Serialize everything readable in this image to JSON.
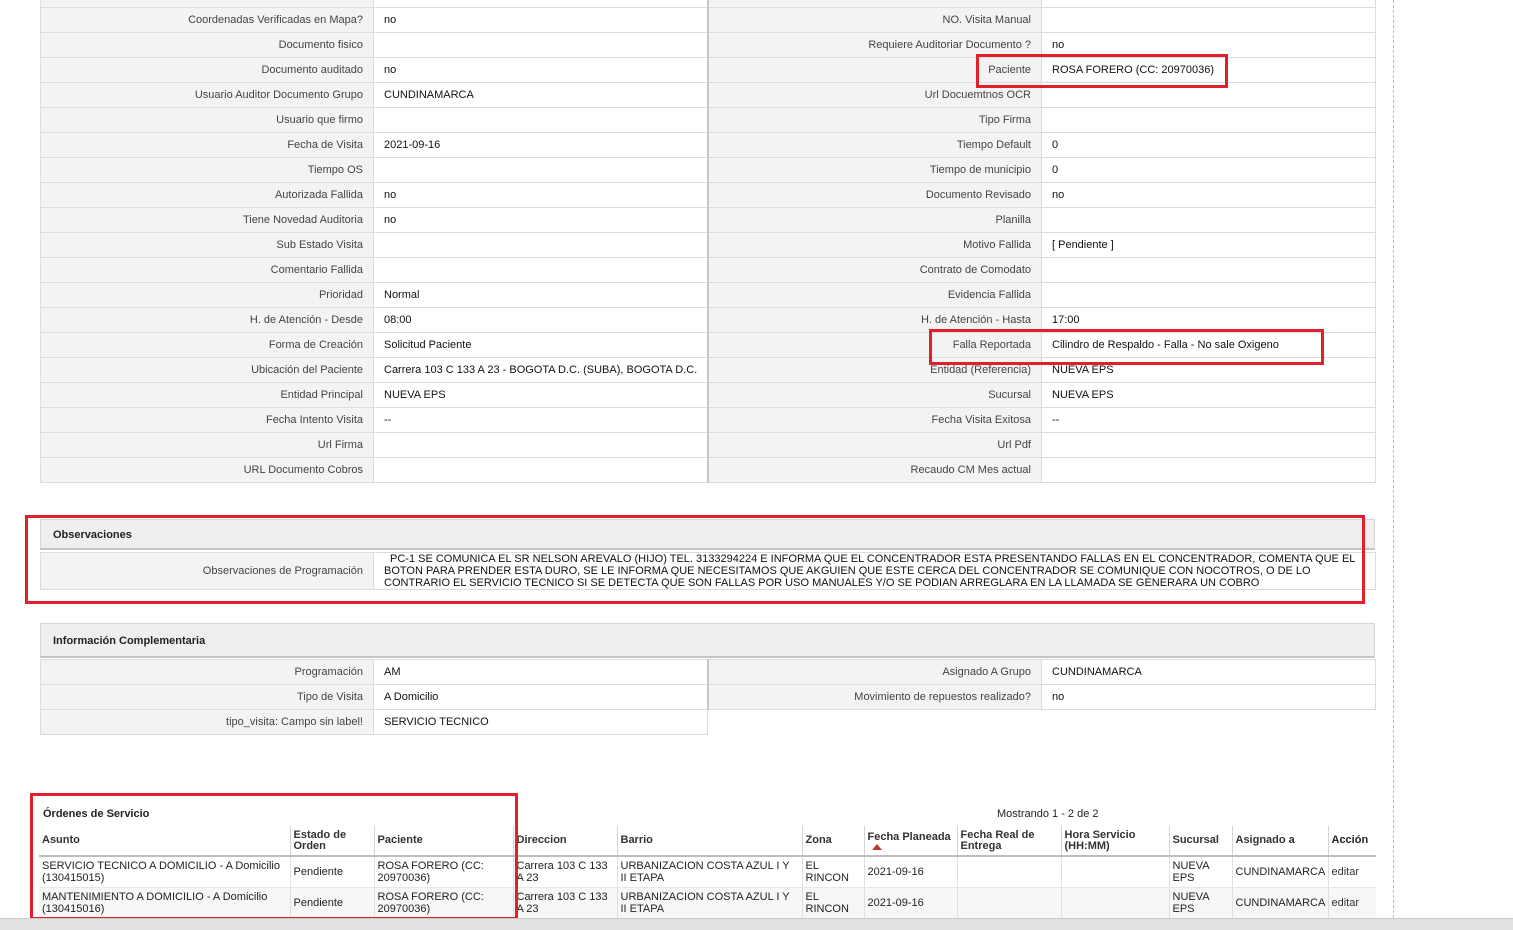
{
  "detail": {
    "rows": [
      {
        "l1": "Coordenadas Verificadas en Mapa?",
        "v1": "no",
        "l2": "NO. Visita Manual",
        "v2": ""
      },
      {
        "l1": "Documento fisico",
        "v1": "",
        "l2": "Requiere Auditoriar Documento ?",
        "v2": "no"
      },
      {
        "l1": "Documento auditado",
        "v1": "no",
        "l2": "Paciente",
        "v2": "ROSA FORERO (CC: 20970036)"
      },
      {
        "l1": "Usuario Auditor Documento Grupo",
        "v1": "CUNDINAMARCA",
        "l2": "Url Docuemtnos OCR",
        "v2": ""
      },
      {
        "l1": "Usuario que firmo",
        "v1": "",
        "l2": "Tipo Firma",
        "v2": ""
      },
      {
        "l1": "Fecha de Visita",
        "v1": "2021-09-16",
        "l2": "Tiempo Default",
        "v2": "0"
      },
      {
        "l1": "Tiempo OS",
        "v1": "",
        "l2": "Tiempo de municipio",
        "v2": "0"
      },
      {
        "l1": "Autorizada Fallida",
        "v1": "no",
        "l2": "Documento Revisado",
        "v2": "no"
      },
      {
        "l1": "Tiene Novedad Auditoria",
        "v1": "no",
        "l2": "Planilla",
        "v2": ""
      },
      {
        "l1": "Sub Estado Visita",
        "v1": "",
        "l2": "Motivo Fallida",
        "v2": "[ Pendiente ]"
      },
      {
        "l1": "Comentario Fallida",
        "v1": "",
        "l2": "Contrato de Comodato",
        "v2": ""
      },
      {
        "l1": "Prioridad",
        "v1": "Normal",
        "l2": "Evidencia Fallida",
        "v2": ""
      },
      {
        "l1": "H. de Atención - Desde",
        "v1": "08:00",
        "l2": "H. de Atención - Hasta",
        "v2": "17:00"
      },
      {
        "l1": "Forma de Creación",
        "v1": "Solicitud Paciente",
        "l2": "Falla Reportada",
        "v2": "Cilindro de Respaldo - Falla - No sale Oxigeno"
      },
      {
        "l1": "Ubicación del Paciente",
        "v1": "Carrera 103 C 133 A 23 - BOGOTA D.C. (SUBA), BOGOTA D.C.",
        "l2": "Entidad (Referencia)",
        "v2": "NUEVA EPS"
      },
      {
        "l1": "Entidad Principal",
        "v1": "NUEVA EPS",
        "l2": "Sucursal",
        "v2": "NUEVA EPS"
      },
      {
        "l1": "Fecha Intento Visita",
        "v1": "--",
        "l2": "Fecha Visita Exitosa",
        "v2": "--"
      },
      {
        "l1": "Url Firma",
        "v1": "",
        "l2": "Url Pdf",
        "v2": ""
      },
      {
        "l1": "URL Documento Cobros",
        "v1": "",
        "l2": "Recaudo CM Mes actual",
        "v2": ""
      }
    ]
  },
  "observaciones": {
    "title": "Observaciones",
    "label": "Observaciones de Programación",
    "value": "PC-1 SE COMUNICA EL SR NELSON AREVALO (HIJO) TEL. 3133294224 E INFORMA QUE EL CONCENTRADOR ESTA PRESENTANDO FALLAS EN EL CONCENTRADOR, COMENTA QUE EL BOTON PARA PRENDER ESTA DURO, SE LE INFORMA QUE NECESITAMOS QUE AKGUIEN QUE ESTE CERCA DEL CONCENTRADOR SE COMUNIQUE CON NOCOTROS, O DE LO CONTRARIO EL SERVICIO TECNICO SI SE DETECTA QUE SON FALLAS POR USO MANUALES Y/O SE PODIAN ARREGLARA EN LA LLAMADA SE GENERARA UN COBRO"
  },
  "complementaria": {
    "title": "Información Complementaria",
    "rows": [
      {
        "l1": "Programación",
        "v1": "AM",
        "l2": "Asignado A Grupo",
        "v2": "CUNDINAMARCA"
      },
      {
        "l1": "Tipo de Visita",
        "v1": "A Domicilio",
        "l2": "Movimiento de repuestos realizado?",
        "v2": "no"
      },
      {
        "l1": "tipo_visita: Campo sin label!",
        "v1": "SERVICIO TECNICO"
      }
    ]
  },
  "ordenes": {
    "title": "Órdenes de Servicio",
    "pagination": "Mostrando 1 - 2 de 2",
    "columns": [
      "Asunto",
      "Estado de Orden",
      "Paciente",
      "Direccion",
      "Barrio",
      "Zona",
      "Fecha Planeada",
      "Fecha Real de Entrega",
      "Hora Servicio (HH:MM)",
      "Sucursal",
      "Asignado a",
      "Acción"
    ],
    "rows": [
      {
        "asunto": "SERVICIO TECNICO A DOMICILIO - A Domicilio (130415015)",
        "estado": "Pendiente",
        "paciente": "ROSA FORERO (CC: 20970036)",
        "direccion": "Carrera 103 C 133 A 23",
        "barrio": "URBANIZACION COSTA AZUL I Y II ETAPA",
        "zona": "EL RINCON",
        "fecha_planeada": "2021-09-16",
        "fecha_real": "",
        "hora": "",
        "sucursal": "NUEVA EPS",
        "asignado": "CUNDINAMARCA",
        "accion": "editar"
      },
      {
        "asunto": "MANTENIMIENTO A DOMICILIO - A Domicilio (130415016)",
        "estado": "Pendiente",
        "paciente": "ROSA FORERO (CC: 20970036)",
        "direccion": "Carrera 103 C 133 A 23",
        "barrio": "URBANIZACION COSTA AZUL I Y II ETAPA",
        "zona": "EL RINCON",
        "fecha_planeada": "2021-09-16",
        "fecha_real": "",
        "hora": "",
        "sucursal": "NUEVA EPS",
        "asignado": "CUNDINAMARCA",
        "accion": "editar"
      }
    ]
  }
}
